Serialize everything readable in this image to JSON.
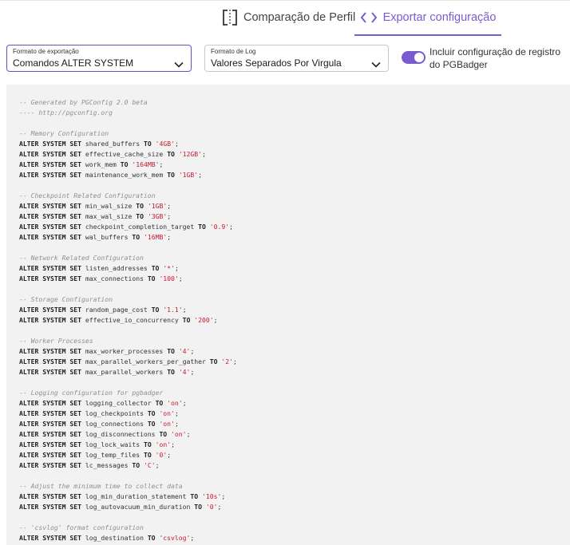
{
  "tabs": [
    {
      "label": "Comparação de Perfil",
      "icon": "bracket-compare-icon",
      "active": false
    },
    {
      "label": "Exportar configuração",
      "icon": "code-icon",
      "active": true
    }
  ],
  "export_format": {
    "label": "Formato de exportação",
    "value": "Comandos ALTER SYSTEM"
  },
  "log_format": {
    "label": "Formato de Log",
    "value": "Valores Separados Por Virgula"
  },
  "pgbadger_toggle": {
    "label": "Incluir configuração de registro do PGBadger",
    "checked": true
  },
  "colors": {
    "accent": "#7a5bd0",
    "string": "#c8192e",
    "comment": "#8f8f8f",
    "code_bg": "#f2f2f2"
  },
  "code_lines": [
    {
      "type": "comment",
      "text": "-- Generated by PGConfig 2.0 beta"
    },
    {
      "type": "comment",
      "text": "---- http://pgconfig.org"
    },
    {
      "type": "blank"
    },
    {
      "type": "comment",
      "text": "-- Memory Configuration"
    },
    {
      "type": "stmt",
      "kw": "ALTER SYSTEM SET",
      "param": "shared_buffers",
      "to": "TO",
      "value": "'4GB'"
    },
    {
      "type": "stmt",
      "kw": "ALTER SYSTEM SET",
      "param": "effective_cache_size",
      "to": "TO",
      "value": "'12GB'"
    },
    {
      "type": "stmt",
      "kw": "ALTER SYSTEM SET",
      "param": "work_mem",
      "to": "TO",
      "value": "'164MB'"
    },
    {
      "type": "stmt",
      "kw": "ALTER SYSTEM SET",
      "param": "maintenance_work_mem",
      "to": "TO",
      "value": "'1GB'"
    },
    {
      "type": "blank"
    },
    {
      "type": "comment",
      "text": "-- Checkpoint Related Configuration"
    },
    {
      "type": "stmt",
      "kw": "ALTER SYSTEM SET",
      "param": "min_wal_size",
      "to": "TO",
      "value": "'1GB'"
    },
    {
      "type": "stmt",
      "kw": "ALTER SYSTEM SET",
      "param": "max_wal_size",
      "to": "TO",
      "value": "'3GB'"
    },
    {
      "type": "stmt",
      "kw": "ALTER SYSTEM SET",
      "param": "checkpoint_completion_target",
      "to": "TO",
      "value": "'0.9'"
    },
    {
      "type": "stmt",
      "kw": "ALTER SYSTEM SET",
      "param": "wal_buffers",
      "to": "TO",
      "value": "'16MB'"
    },
    {
      "type": "blank"
    },
    {
      "type": "comment",
      "text": "-- Network Related Configuration"
    },
    {
      "type": "stmt",
      "kw": "ALTER SYSTEM SET",
      "param": "listen_addresses",
      "to": "TO",
      "value": "'*'"
    },
    {
      "type": "stmt",
      "kw": "ALTER SYSTEM SET",
      "param": "max_connections",
      "to": "TO",
      "value": "'100'"
    },
    {
      "type": "blank"
    },
    {
      "type": "comment",
      "text": "-- Storage Configuration"
    },
    {
      "type": "stmt",
      "kw": "ALTER SYSTEM SET",
      "param": "random_page_cost",
      "to": "TO",
      "value": "'1.1'"
    },
    {
      "type": "stmt",
      "kw": "ALTER SYSTEM SET",
      "param": "effective_io_concurrency",
      "to": "TO",
      "value": "'200'"
    },
    {
      "type": "blank"
    },
    {
      "type": "comment",
      "text": "-- Worker Processes"
    },
    {
      "type": "stmt",
      "kw": "ALTER SYSTEM SET",
      "param": "max_worker_processes",
      "to": "TO",
      "value": "'4'"
    },
    {
      "type": "stmt",
      "kw": "ALTER SYSTEM SET",
      "param": "max_parallel_workers_per_gather",
      "to": "TO",
      "value": "'2'"
    },
    {
      "type": "stmt",
      "kw": "ALTER SYSTEM SET",
      "param": "max_parallel_workers",
      "to": "TO",
      "value": "'4'"
    },
    {
      "type": "blank"
    },
    {
      "type": "comment",
      "text": "-- Logging configuration for pgbadger"
    },
    {
      "type": "stmt",
      "kw": "ALTER SYSTEM SET",
      "param": "logging_collector",
      "to": "TO",
      "value": "'on'"
    },
    {
      "type": "stmt",
      "kw": "ALTER SYSTEM SET",
      "param": "log_checkpoints",
      "to": "TO",
      "value": "'on'"
    },
    {
      "type": "stmt",
      "kw": "ALTER SYSTEM SET",
      "param": "log_connections",
      "to": "TO",
      "value": "'on'"
    },
    {
      "type": "stmt",
      "kw": "ALTER SYSTEM SET",
      "param": "log_disconnections",
      "to": "TO",
      "value": "'on'"
    },
    {
      "type": "stmt",
      "kw": "ALTER SYSTEM SET",
      "param": "log_lock_waits",
      "to": "TO",
      "value": "'on'"
    },
    {
      "type": "stmt",
      "kw": "ALTER SYSTEM SET",
      "param": "log_temp_files",
      "to": "TO",
      "value": "'0'"
    },
    {
      "type": "stmt",
      "kw": "ALTER SYSTEM SET",
      "param": "lc_messages",
      "to": "TO",
      "value": "'C'"
    },
    {
      "type": "blank"
    },
    {
      "type": "comment",
      "text": "-- Adjust the minimum time to collect data"
    },
    {
      "type": "stmt",
      "kw": "ALTER SYSTEM SET",
      "param": "log_min_duration_statement",
      "to": "TO",
      "value": "'10s'"
    },
    {
      "type": "stmt",
      "kw": "ALTER SYSTEM SET",
      "param": "log_autovacuum_min_duration",
      "to": "TO",
      "value": "'0'"
    },
    {
      "type": "blank"
    },
    {
      "type": "comment",
      "text": "-- 'csvlog' format configuration"
    },
    {
      "type": "stmt",
      "kw": "ALTER SYSTEM SET",
      "param": "log_destination",
      "to": "TO",
      "value": "'csvlog'"
    }
  ]
}
